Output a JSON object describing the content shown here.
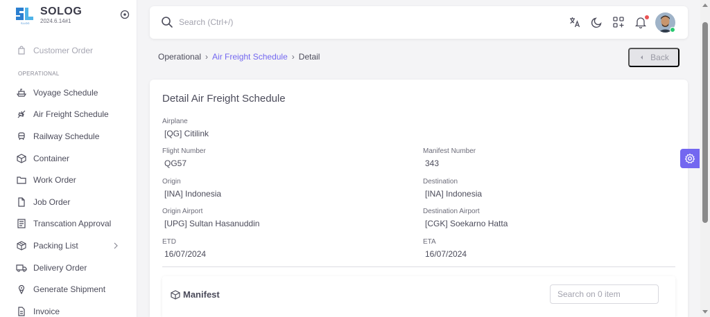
{
  "brand": {
    "name": "SOLOG",
    "version": "2024.6.14#1",
    "logo_sub": "S-LOG"
  },
  "sidebar": {
    "top_item": {
      "label": "Customer Order",
      "icon": "bag-icon"
    },
    "section": "OPERATIONAL",
    "items": [
      {
        "label": "Voyage Schedule",
        "icon": "ship-icon"
      },
      {
        "label": "Air Freight Schedule",
        "icon": "plane-icon"
      },
      {
        "label": "Railway Schedule",
        "icon": "train-icon"
      },
      {
        "label": "Container",
        "icon": "box-icon"
      },
      {
        "label": "Work Order",
        "icon": "folder-icon"
      },
      {
        "label": "Job Order",
        "icon": "file-icon"
      },
      {
        "label": "Transcation Approval",
        "icon": "checklist-icon"
      },
      {
        "label": "Packing List",
        "icon": "package-icon"
      },
      {
        "label": "Delivery Order",
        "icon": "truck-icon"
      },
      {
        "label": "Generate Shipment",
        "icon": "route-icon"
      },
      {
        "label": "Invoice",
        "icon": "invoice-icon"
      }
    ]
  },
  "topbar": {
    "search_placeholder": "Search (Ctrl+/)"
  },
  "breadcrumb": {
    "root": "Operational",
    "parent": "Air Freight Schedule",
    "current": "Detail",
    "separator": "›"
  },
  "back_label": "Back",
  "detail": {
    "title": "Detail Air Freight Schedule",
    "airplane": {
      "label": "Airplane",
      "value": "[QG] Citilink"
    },
    "flight_number": {
      "label": "Flight Number",
      "value": "QG57"
    },
    "manifest_number": {
      "label": "Manifest Number",
      "value": "343"
    },
    "origin": {
      "label": "Origin",
      "value": "[INA] Indonesia"
    },
    "destination": {
      "label": "Destination",
      "value": "[INA] Indonesia"
    },
    "origin_airport": {
      "label": "Origin Airport",
      "value": "[UPG] Sultan Hasanuddin"
    },
    "destination_airport": {
      "label": "Destination Airport",
      "value": "[CGK] Soekarno Hatta"
    },
    "etd": {
      "label": "ETD",
      "value": "16/07/2024"
    },
    "eta": {
      "label": "ETA",
      "value": "16/07/2024"
    }
  },
  "manifest": {
    "title": "Manifest",
    "search_placeholder": "Search on 0 item"
  },
  "colors": {
    "accent": "#7367f0",
    "notification": "#ea5455",
    "online": "#28c76f"
  }
}
